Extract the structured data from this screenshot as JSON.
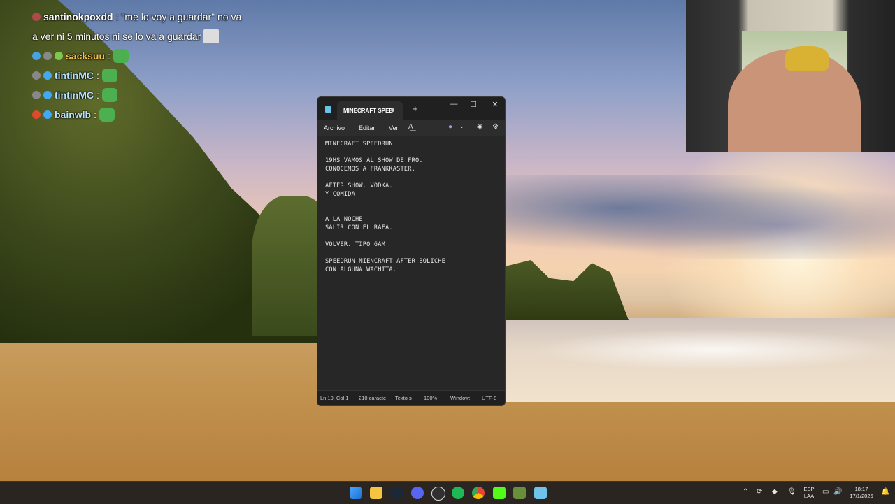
{
  "chat": {
    "messages": [
      {
        "user": "santinokpoxdd",
        "text": "\"me lo voy a guardar\" no va"
      },
      {
        "user": "",
        "text": "a ver ni 5 minutos ni se lo va a guardar"
      },
      {
        "user": "sacksuu",
        "text": ""
      },
      {
        "user": "tintinMC",
        "text": ""
      },
      {
        "user": "tintinMC",
        "text": ""
      },
      {
        "user": "bainwlb",
        "text": ""
      }
    ]
  },
  "notepad": {
    "tab_title": "MINECRAFT SPEE",
    "new_tab": "+",
    "window_controls": {
      "minimize": "—",
      "maximize": "☐",
      "close": "✕"
    },
    "menu": {
      "file": "Archivo",
      "edit": "Editar",
      "view": "Ver"
    },
    "lines": [
      "MINECRAFT SPEEDRUN",
      "",
      "19HS VAMOS AL SHOW DE FRO.",
      "CONOCEMOS A FRANKKASTER.",
      "",
      "AFTER SHOW. VODKA.",
      "Y COMIDA",
      "",
      "",
      "A LA NOCHE",
      "SALIR CON EL RAFA.",
      "",
      "VOLVER. TIPO 6AM",
      "",
      "SPEEDRUN MIENCRAFT AFTER BOLICHE",
      "CON ALGUNA WACHITA."
    ],
    "status": {
      "position": "Ln 19, Col 1",
      "chars": "210 caracte",
      "format": "Texto s",
      "zoom": "100%",
      "line_ending": "Window:",
      "encoding": "UTF-8"
    }
  },
  "taskbar": {
    "language": "ESP",
    "layout": "LAA",
    "time": "18:17",
    "date": "17/1/2026",
    "apps": [
      "windows-start",
      "file-explorer",
      "steam",
      "discord",
      "obs",
      "spotify",
      "chrome",
      "kick",
      "minecraft",
      "notepad"
    ]
  }
}
